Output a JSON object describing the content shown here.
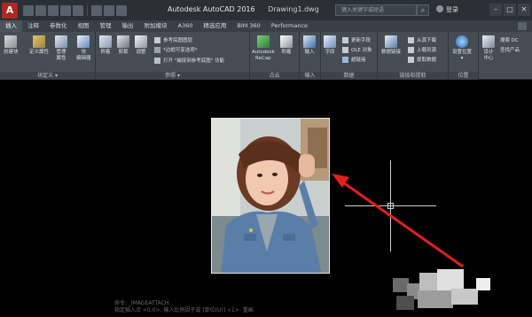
{
  "titlebar": {
    "app_logo": "A",
    "app_title": "Autodesk AutoCAD 2016",
    "file_name": "Drawing1.dwg",
    "search_placeholder": "键入关键字或短语",
    "login_label": "登录",
    "minimize": "–",
    "maximize": "□",
    "close": "✕"
  },
  "tabs": [
    "插入",
    "注释",
    "参数化",
    "视图",
    "管理",
    "输出",
    "附加模块",
    "A360",
    "精选应用",
    "BIM 360",
    "Performance"
  ],
  "ribbon": {
    "groups": {
      "block_def": {
        "label": "块定义 ▾",
        "tools": [
          "创建块",
          "定义属性",
          "管理\n属性",
          "块\n编辑器"
        ]
      },
      "reference": {
        "label": "参照 ▾",
        "tools": [
          "附着",
          "剪裁",
          "调整"
        ],
        "small": [
          "参考底图图层",
          "*边框可变选项*",
          "打开 \"捕捉到参考底图\" 功能"
        ]
      },
      "point_cloud": {
        "label": "点云",
        "tools": [
          "Autodesk\nReCap",
          "附着"
        ]
      },
      "import": {
        "label": "输入",
        "tools": [
          "输入"
        ]
      },
      "data": {
        "label": "数据",
        "tools": [
          "字段"
        ],
        "small": [
          "更新字段",
          "OLE 对象",
          "超链接"
        ]
      },
      "linking": {
        "label": "链接和提取",
        "tools": [
          "数据链接"
        ],
        "small": [
          "从源下载",
          "上载到源",
          "提取数据"
        ]
      },
      "location": {
        "label": "位置",
        "tools": [
          "设置位置\n▾"
        ]
      },
      "content": {
        "label": "",
        "tools": [
          "设计\n中心"
        ],
        "small": [
          "搜索 DC",
          "查找产品"
        ]
      }
    }
  },
  "canvas": {
    "command_line": [
      "命令: _IMAGEATTACH",
      "指定插入点 <0,0>: 输入比例因子或 [单位(U)] <1>: 重画"
    ]
  },
  "colors": {
    "arrow": "#e02020",
    "titlebar": "#2b3036",
    "ribbon": "#454c54",
    "canvas": "#000000"
  }
}
